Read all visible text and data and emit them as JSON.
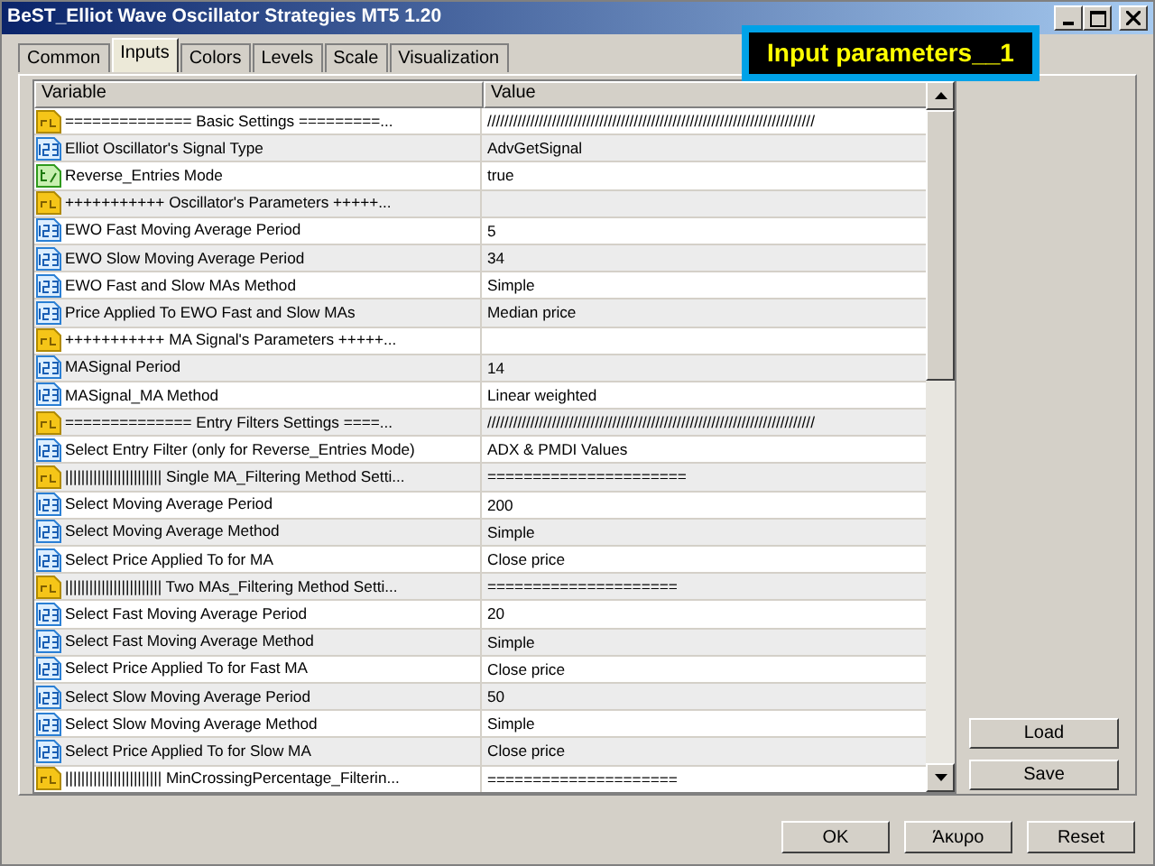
{
  "window": {
    "title": "BeST_Elliot Wave Oscillator Strategies MT5 1.20"
  },
  "overlay_label": "Input parameters__1",
  "tabs": [
    {
      "label": "Common",
      "selected": false
    },
    {
      "label": "Inputs",
      "selected": true
    },
    {
      "label": "Colors",
      "selected": false
    },
    {
      "label": "Levels",
      "selected": false
    },
    {
      "label": "Scale",
      "selected": false
    },
    {
      "label": "Visualization",
      "selected": false
    }
  ],
  "table": {
    "columns": [
      "Variable",
      "Value"
    ],
    "rows": [
      {
        "kind": "string",
        "variable": "============== Basic Settings =========...",
        "value": "////////////////////////////////////////////////////////////////////////////"
      },
      {
        "kind": "number",
        "variable": "Elliot Oscillator's Signal Type",
        "value": "AdvGetSignal"
      },
      {
        "kind": "bool",
        "variable": "Reverse_Entries Mode",
        "value": "true"
      },
      {
        "kind": "string",
        "variable": "+++++++++++   Oscillator's Parameters   +++++...",
        "value": ""
      },
      {
        "kind": "number",
        "variable": "EWO Fast Moving Average Period",
        "value": "5"
      },
      {
        "kind": "number",
        "variable": "EWO Slow Moving Average Period",
        "value": "34"
      },
      {
        "kind": "number",
        "variable": "EWO Fast and Slow MAs Method",
        "value": "Simple"
      },
      {
        "kind": "number",
        "variable": "Price Applied To EWO Fast and Slow MAs",
        "value": "Median price"
      },
      {
        "kind": "string",
        "variable": "+++++++++++   MA Signal's Parameters   +++++...",
        "value": ""
      },
      {
        "kind": "number",
        "variable": "MASignal Period",
        "value": "14"
      },
      {
        "kind": "number",
        "variable": "MASignal_MA Method",
        "value": "Linear weighted"
      },
      {
        "kind": "string",
        "variable": "============== Entry Filters Settings  ====...",
        "value": "////////////////////////////////////////////////////////////////////////////"
      },
      {
        "kind": "number",
        "variable": "Select Entry Filter (only for Reverse_Entries Mode)",
        "value": "ADX & PMDI Values"
      },
      {
        "kind": "string",
        "variable": "||||||||||||||||||||||||      Single MA_Filtering Method Setti...",
        "value": "======================"
      },
      {
        "kind": "number",
        "variable": "Select Moving Average Period",
        "value": "200"
      },
      {
        "kind": "number",
        "variable": "Select Moving Average Method",
        "value": "Simple"
      },
      {
        "kind": "number",
        "variable": "Select Price Applied To for MA",
        "value": "Close price"
      },
      {
        "kind": "string",
        "variable": "||||||||||||||||||||||||      Two MAs_Filtering Method Setti...",
        "value": "====================="
      },
      {
        "kind": "number",
        "variable": "Select Fast Moving Average Period",
        "value": "20"
      },
      {
        "kind": "number",
        "variable": "Select Fast Moving Average Method",
        "value": "Simple"
      },
      {
        "kind": "number",
        "variable": "Select Price Applied To for Fast MA",
        "value": "Close price"
      },
      {
        "kind": "number",
        "variable": "Select Slow Moving Average Period",
        "value": "50"
      },
      {
        "kind": "number",
        "variable": "Select Slow Moving Average Method",
        "value": "Simple"
      },
      {
        "kind": "number",
        "variable": "Select Price Applied To for Slow MA",
        "value": "Close price"
      },
      {
        "kind": "string",
        "variable": "||||||||||||||||||||||||      MinCrossingPercentage_Filterin...",
        "value": "====================="
      }
    ]
  },
  "side_buttons": [
    "Load",
    "Save"
  ],
  "buttons": [
    "OK",
    "Άκυρο",
    "Reset"
  ]
}
